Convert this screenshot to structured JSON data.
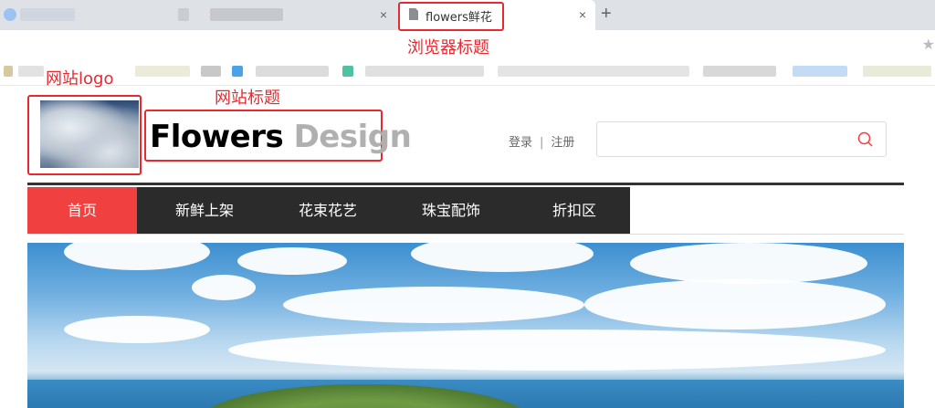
{
  "browser": {
    "active_tab_title": "flowers鲜花",
    "new_tab_symbol": "+",
    "close_symbol": "×"
  },
  "annotations": {
    "browser_title": "浏览器标题",
    "site_logo": "网站logo",
    "site_title": "网站标题"
  },
  "site": {
    "title_main": "Flowers",
    "title_accent": "Design",
    "login": "登录",
    "separator": "|",
    "register": "注册",
    "search_placeholder": "",
    "nav": [
      {
        "label": "首页",
        "active": true
      },
      {
        "label": "新鲜上架",
        "active": false
      },
      {
        "label": "花束花艺",
        "active": false
      },
      {
        "label": "珠宝配饰",
        "active": false
      },
      {
        "label": "折扣区",
        "active": false
      }
    ]
  },
  "colors": {
    "accent_red": "#f14040",
    "nav_dark": "#2b2b2b",
    "annotation_red": "#e8292f"
  }
}
